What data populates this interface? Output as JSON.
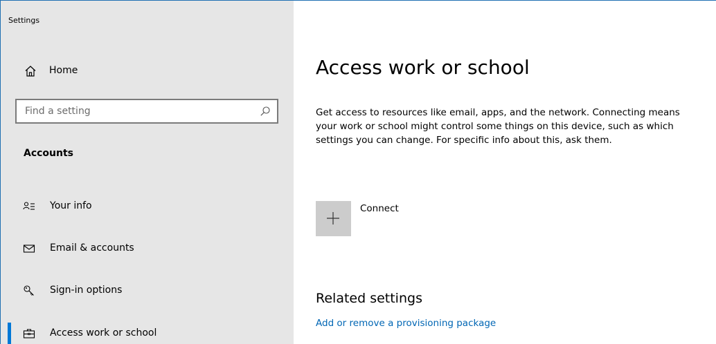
{
  "app_title": "Settings",
  "sidebar": {
    "home_label": "Home",
    "search_placeholder": "Find a setting",
    "section_header": "Accounts",
    "items": [
      {
        "label": "Your info",
        "icon": "person-list-icon",
        "active": false
      },
      {
        "label": "Email & accounts",
        "icon": "envelope-icon",
        "active": false
      },
      {
        "label": "Sign-in options",
        "icon": "key-icon",
        "active": false
      },
      {
        "label": "Access work or school",
        "icon": "briefcase-icon",
        "active": true
      }
    ]
  },
  "main": {
    "title": "Access work or school",
    "description": "Get access to resources like email, apps, and the network. Connecting means your work or school might control some things on this device, such as which settings you can change. For specific info about this, ask them.",
    "connect_label": "Connect",
    "related_title": "Related settings",
    "related_link": "Add or remove a provisioning package"
  },
  "colors": {
    "accent": "#0078d7",
    "link": "#0066b4",
    "sidebar_bg": "#e6e6e6",
    "tile_bg": "#cccccc"
  }
}
